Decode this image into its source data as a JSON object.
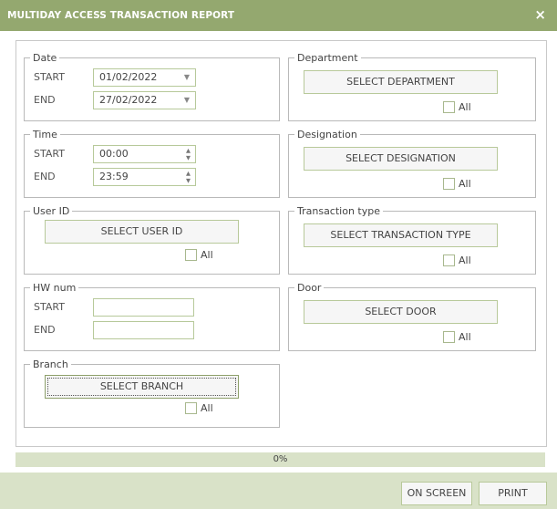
{
  "window": {
    "title": "MULTIDAY ACCESS TRANSACTION REPORT",
    "close_glyph": "×"
  },
  "date": {
    "legend": "Date",
    "start_label": "START",
    "start_value": "01/02/2022",
    "end_label": "END",
    "end_value": "27/02/2022"
  },
  "time": {
    "legend": "Time",
    "start_label": "START",
    "start_value": "00:00",
    "end_label": "END",
    "end_value": "23:59"
  },
  "user_id": {
    "legend": "User ID",
    "button": "SELECT USER ID",
    "all_label": "All"
  },
  "hw_num": {
    "legend": "HW num",
    "start_label": "START",
    "start_value": "",
    "end_label": "END",
    "end_value": ""
  },
  "branch": {
    "legend": "Branch",
    "button": "SELECT BRANCH",
    "all_label": "All"
  },
  "department": {
    "legend": "Department",
    "button": "SELECT DEPARTMENT",
    "all_label": "All"
  },
  "designation": {
    "legend": "Designation",
    "button": "SELECT DESIGNATION",
    "all_label": "All"
  },
  "transaction_type": {
    "legend": "Transaction type",
    "button": "SELECT TRANSACTION TYPE",
    "all_label": "All"
  },
  "door": {
    "legend": "Door",
    "button": "SELECT DOOR",
    "all_label": "All"
  },
  "progress": {
    "text": "0%",
    "value_percent": 0
  },
  "footer": {
    "on_screen": "ON SCREEN",
    "print": "PRINT"
  },
  "icons": {
    "dropdown": "chevron-down-icon",
    "spinner": "spinner-arrows-icon",
    "close": "close-icon"
  },
  "colors": {
    "accent": "#94a86f",
    "accent_light": "#d9e2c8",
    "border": "#b8c99a"
  }
}
